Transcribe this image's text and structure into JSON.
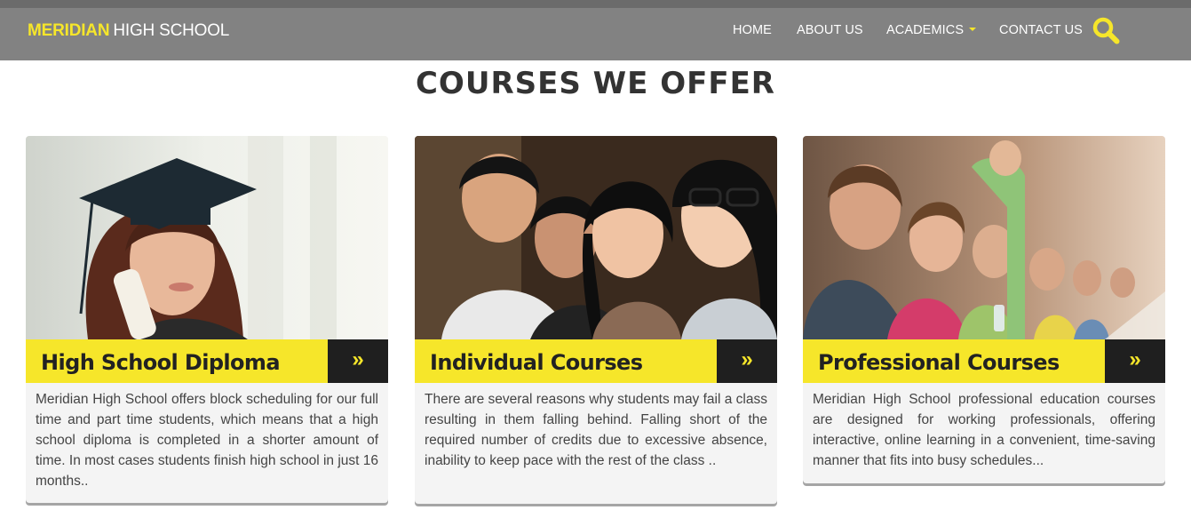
{
  "brand": {
    "highlight": "MERIDIAN",
    "rest": "HIGH SCHOOL"
  },
  "nav": {
    "home": "HOME",
    "about": "ABOUT US",
    "academics": "ACADEMICS",
    "contact": "CONTACT US"
  },
  "section": {
    "title": "COURSES WE OFFER"
  },
  "courses": [
    {
      "title": "High School Diploma",
      "arrow": "»",
      "description": "Meridian High School offers block scheduling for our full time and part time students, which means that a high school diploma is completed in a shorter amount of time. In most cases students finish high school in just 16 months.."
    },
    {
      "title": "Individual Courses",
      "arrow": "»",
      "description": "There are several reasons why students may fail a class resulting in them falling behind. Falling short of the required number of credits due to excessive absence, inability to keep pace with the rest of the class .."
    },
    {
      "title": "Professional Courses",
      "arrow": "»",
      "description": "Meridian High School professional education courses are designed for working professionals, offering interactive, online learning in a convenient, time-saving manner that fits into busy schedules..."
    }
  ],
  "icons": {
    "search": "search-icon",
    "dropdown": "caret-down-icon",
    "arrow": "double-chevron-right-icon"
  },
  "colors": {
    "accent": "#f6e62a",
    "navbar": "#828282",
    "dark": "#1f1f1f"
  }
}
